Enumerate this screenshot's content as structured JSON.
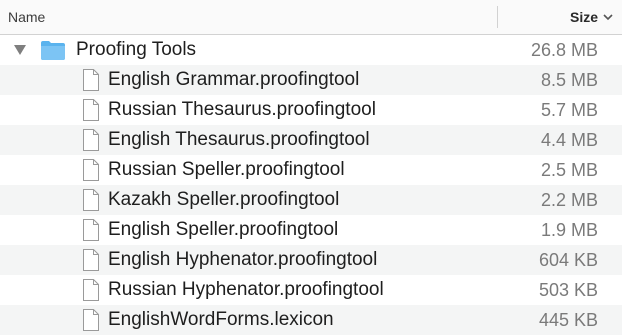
{
  "header": {
    "name_label": "Name",
    "size_label": "Size"
  },
  "folder": {
    "name": "Proofing Tools",
    "size": "26.8 MB",
    "icon": "folder-icon",
    "color": "#5ab3ee"
  },
  "files": [
    {
      "name": "English Grammar.proofingtool",
      "size": "8.5 MB"
    },
    {
      "name": "Russian Thesaurus.proofingtool",
      "size": "5.7 MB"
    },
    {
      "name": "English Thesaurus.proofingtool",
      "size": "4.4 MB"
    },
    {
      "name": "Russian Speller.proofingtool",
      "size": "2.5 MB"
    },
    {
      "name": "Kazakh Speller.proofingtool",
      "size": "2.2 MB"
    },
    {
      "name": "English Speller.proofingtool",
      "size": "1.9 MB"
    },
    {
      "name": "English Hyphenator.proofingtool",
      "size": "604 KB"
    },
    {
      "name": "Russian Hyphenator.proofingtool",
      "size": "503 KB"
    },
    {
      "name": "EnglishWordForms.lexicon",
      "size": "445 KB"
    }
  ]
}
